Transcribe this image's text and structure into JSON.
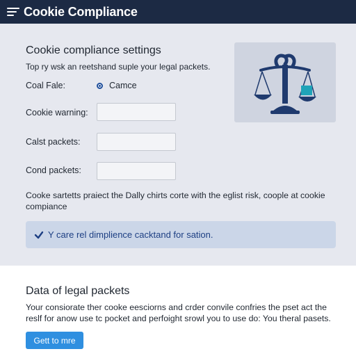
{
  "app": {
    "title": "Cookie Compliance",
    "logo_icon": "menu-lines-icon"
  },
  "settings": {
    "title": "Cookie compliance settings",
    "subtitle": "Top ry wsk an reetshand suple your legal packets.",
    "radio_row": {
      "label": "Coal Fale:",
      "option_label": "Camce",
      "selected": true
    },
    "fields": [
      {
        "label": "Cookie warning:",
        "value": ""
      },
      {
        "label": "Calst packets:",
        "value": ""
      },
      {
        "label": "Cond packets:",
        "value": ""
      }
    ],
    "illustration_icon": "scales-of-justice-icon",
    "paragraph": "Cooke sartetts praiect the Dally chirts corte with the eglist risk, coople at cookie compiance",
    "info": {
      "icon": "check-icon",
      "text": "Y care rel dimplience cacktand for sation."
    }
  },
  "legal": {
    "title": "Data of legal packets",
    "text": "Your consiorate ther cooke eesciorns and crder convile confries the pset act the reslf for anow use tc pocket and perfoight srowl you to use do: You theral pasets.",
    "cta_label": "Gett to mre"
  },
  "colors": {
    "topbar": "#1c2a44",
    "panel": "#e6e8ef",
    "accent": "#2f8fe0",
    "info_bg": "#cbd6e8",
    "info_text": "#1d3f83",
    "scale_navy": "#1f3a6e",
    "scale_teal": "#1fa3b8"
  }
}
